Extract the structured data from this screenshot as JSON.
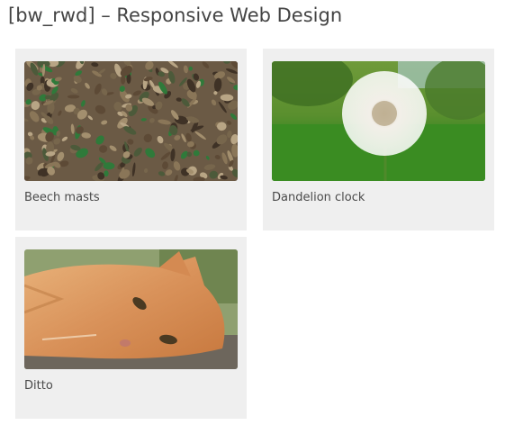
{
  "page": {
    "title": "[bw_rwd] – Responsive Web Design"
  },
  "gallery": {
    "items": [
      {
        "caption": "Beech masts",
        "image": "forest-floor-leaves-photo"
      },
      {
        "caption": "Dandelion clock",
        "image": "dandelion-seed-head-photo"
      },
      {
        "caption": "Ditto",
        "image": "ginger-cat-lying-photo"
      }
    ]
  }
}
